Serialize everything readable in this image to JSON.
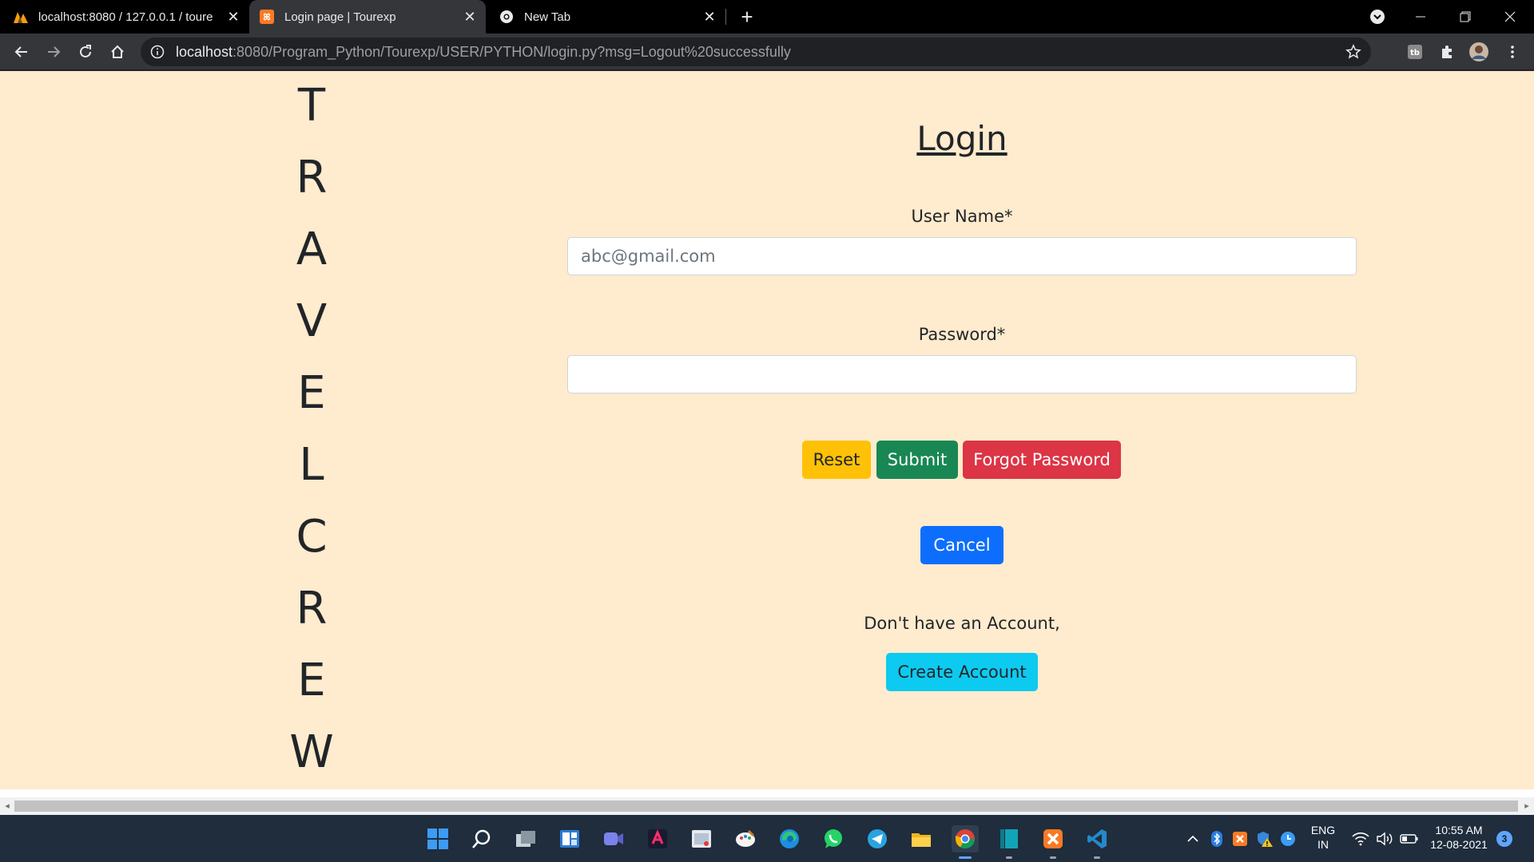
{
  "browser": {
    "tabs": [
      {
        "title": "localhost:8080 / 127.0.0.1 / toure",
        "icon": "phpmyadmin-icon",
        "active": false
      },
      {
        "title": "Login page | Tourexp",
        "icon": "xampp-icon",
        "active": true
      },
      {
        "title": "New Tab",
        "icon": "chrome-icon",
        "active": false
      }
    ],
    "url_host": "localhost",
    "url_rest": ":8080/Program_Python/Tourexp/USER/PYTHON/login.py?msg=Logout%20successfully"
  },
  "page": {
    "brand_letters": [
      "T",
      "R",
      "A",
      "V",
      "E",
      "L",
      "C",
      "R",
      "E",
      "W"
    ],
    "title": "Login",
    "username_label": "User Name*",
    "username_placeholder": "abc@gmail.com",
    "username_value": "",
    "password_label": "Password*",
    "password_value": "",
    "buttons": {
      "reset": "Reset",
      "submit": "Submit",
      "forgot": "Forgot Password",
      "cancel": "Cancel",
      "create": "Create Account"
    },
    "no_account_text": "Don't have an Account,",
    "background_color": "#ffebcd"
  },
  "taskbar": {
    "apps": [
      "windows-start-icon",
      "search-icon",
      "task-view-icon",
      "widgets-icon",
      "teams-chat-icon",
      "app-red-icon",
      "app-window-icon",
      "app-paint-icon",
      "edge-icon",
      "whatsapp-icon",
      "telegram-icon",
      "file-explorer-icon",
      "chrome-icon",
      "app-teal-icon",
      "xampp-icon",
      "vscode-icon"
    ],
    "language": "ENG",
    "region": "IN",
    "time": "10:55 AM",
    "date": "12-08-2021",
    "notification_count": "3"
  }
}
